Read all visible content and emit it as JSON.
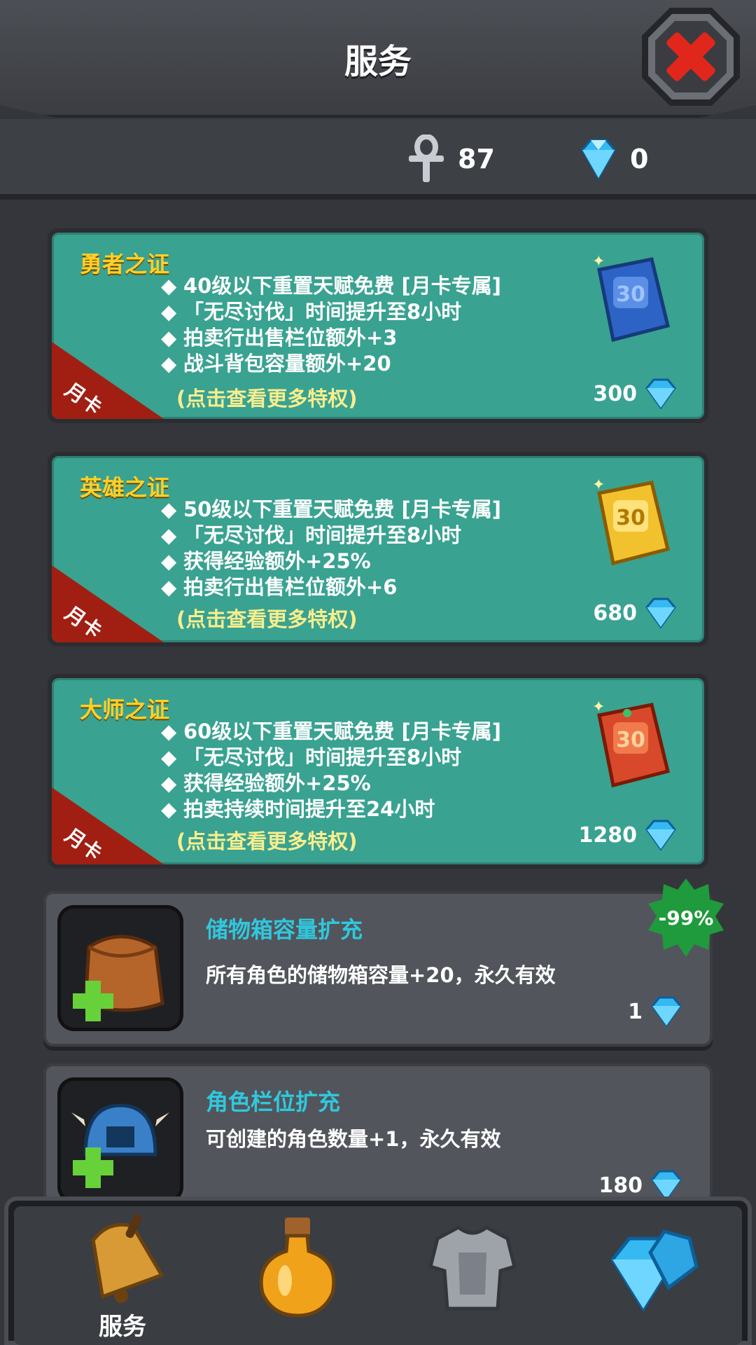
{
  "header": {
    "title": "服务"
  },
  "currency": {
    "ankh": "87",
    "gems": "0"
  },
  "cards": [
    {
      "name": "勇者之证",
      "badge": "月卡",
      "perks": [
        "40级以下重置天赋免费 [月卡专属]",
        "「无尽讨伐」时间提升至8小时",
        "拍卖行出售栏位额外+3",
        "战斗背包容量额外+20"
      ],
      "more": "(点击查看更多特权)",
      "price": "300",
      "icon": "blue-30-card-icon",
      "color": "#3c6fd6"
    },
    {
      "name": "英雄之证",
      "badge": "月卡",
      "perks": [
        "50级以下重置天赋免费 [月卡专属]",
        "「无尽讨伐」时间提升至8小时",
        "获得经验额外+25%",
        "拍卖行出售栏位额外+6"
      ],
      "more": "(点击查看更多特权)",
      "price": "680",
      "icon": "gold-30-card-icon",
      "color": "#f2c12e"
    },
    {
      "name": "大师之证",
      "badge": "月卡",
      "perks": [
        "60级以下重置天赋免费 [月卡专属]",
        "「无尽讨伐」时间提升至8小时",
        "获得经验额外+25%",
        "拍卖持续时间提升至24小时"
      ],
      "more": "(点击查看更多特权)",
      "price": "1280",
      "icon": "red-30-card-icon",
      "color": "#d8482a"
    }
  ],
  "utilities": [
    {
      "title": "储物箱容量扩充",
      "desc": "所有角色的储物箱容量+20，永久有效",
      "price": "1",
      "discount": "-99%",
      "icon": "satchel-plus-icon"
    },
    {
      "title": "角色栏位扩充",
      "desc": "可创建的角色数量+1，永久有效",
      "price": "180",
      "icon": "helmet-plus-icon"
    }
  ],
  "nav": {
    "active_label": "服务",
    "tabs": [
      "bell-icon",
      "potion-icon",
      "armor-icon",
      "gems-icon"
    ]
  },
  "colors": {
    "card_bg": "#39a291",
    "card_title": "#ffd02a",
    "util_title": "#30c8dd",
    "ribbon": "#a11f12",
    "discount": "#1f9a3c"
  }
}
